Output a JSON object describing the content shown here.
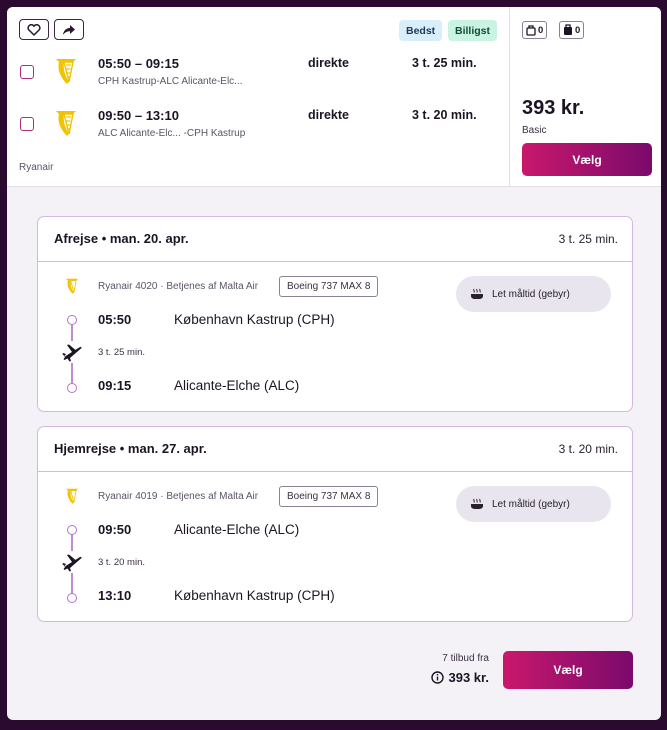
{
  "summary": {
    "badges": {
      "best": "Bedst",
      "cheapest": "Billigst"
    },
    "segments": [
      {
        "times": "05:50 – 09:15",
        "route": "CPH Kastrup-ALC Alicante-Elc...",
        "stops": "direkte",
        "duration": "3 t. 25 min."
      },
      {
        "times": "09:50 – 13:10",
        "route": "ALC Alicante-Elc... -CPH Kastrup",
        "stops": "direkte",
        "duration": "3 t. 20 min."
      }
    ],
    "carrier": "Ryanair",
    "baggage": {
      "personal": "0",
      "cabin": "0"
    },
    "price": "393 kr.",
    "fare": "Basic",
    "select_label": "Vælg"
  },
  "legs": [
    {
      "title": "Afrejse • man. 20. apr.",
      "duration": "3 t. 25 min.",
      "operator": "Ryanair 4020 · Betjenes af Malta Air",
      "aircraft": "Boeing 737 MAX 8",
      "meal": "Let måltid (gebyr)",
      "dep_time": "05:50",
      "dep_place": "København Kastrup (CPH)",
      "flight_time": "3 t. 25 min.",
      "arr_time": "09:15",
      "arr_place": "Alicante-Elche (ALC)"
    },
    {
      "title": "Hjemrejse • man. 27. apr.",
      "duration": "3 t. 20 min.",
      "operator": "Ryanair 4019 · Betjenes af Malta Air",
      "aircraft": "Boeing 737 MAX 8",
      "meal": "Let måltid (gebyr)",
      "dep_time": "09:50",
      "dep_place": "Alicante-Elche (ALC)",
      "flight_time": "3 t. 20 min.",
      "arr_time": "13:10",
      "arr_place": "København Kastrup (CPH)"
    }
  ],
  "footer": {
    "offers": "7 tilbud fra",
    "price": "393 kr.",
    "select_label": "Vælg"
  },
  "colors": {
    "accent_start": "#c9186c",
    "accent_end": "#7a0a6c",
    "logo": "#f2c300"
  }
}
